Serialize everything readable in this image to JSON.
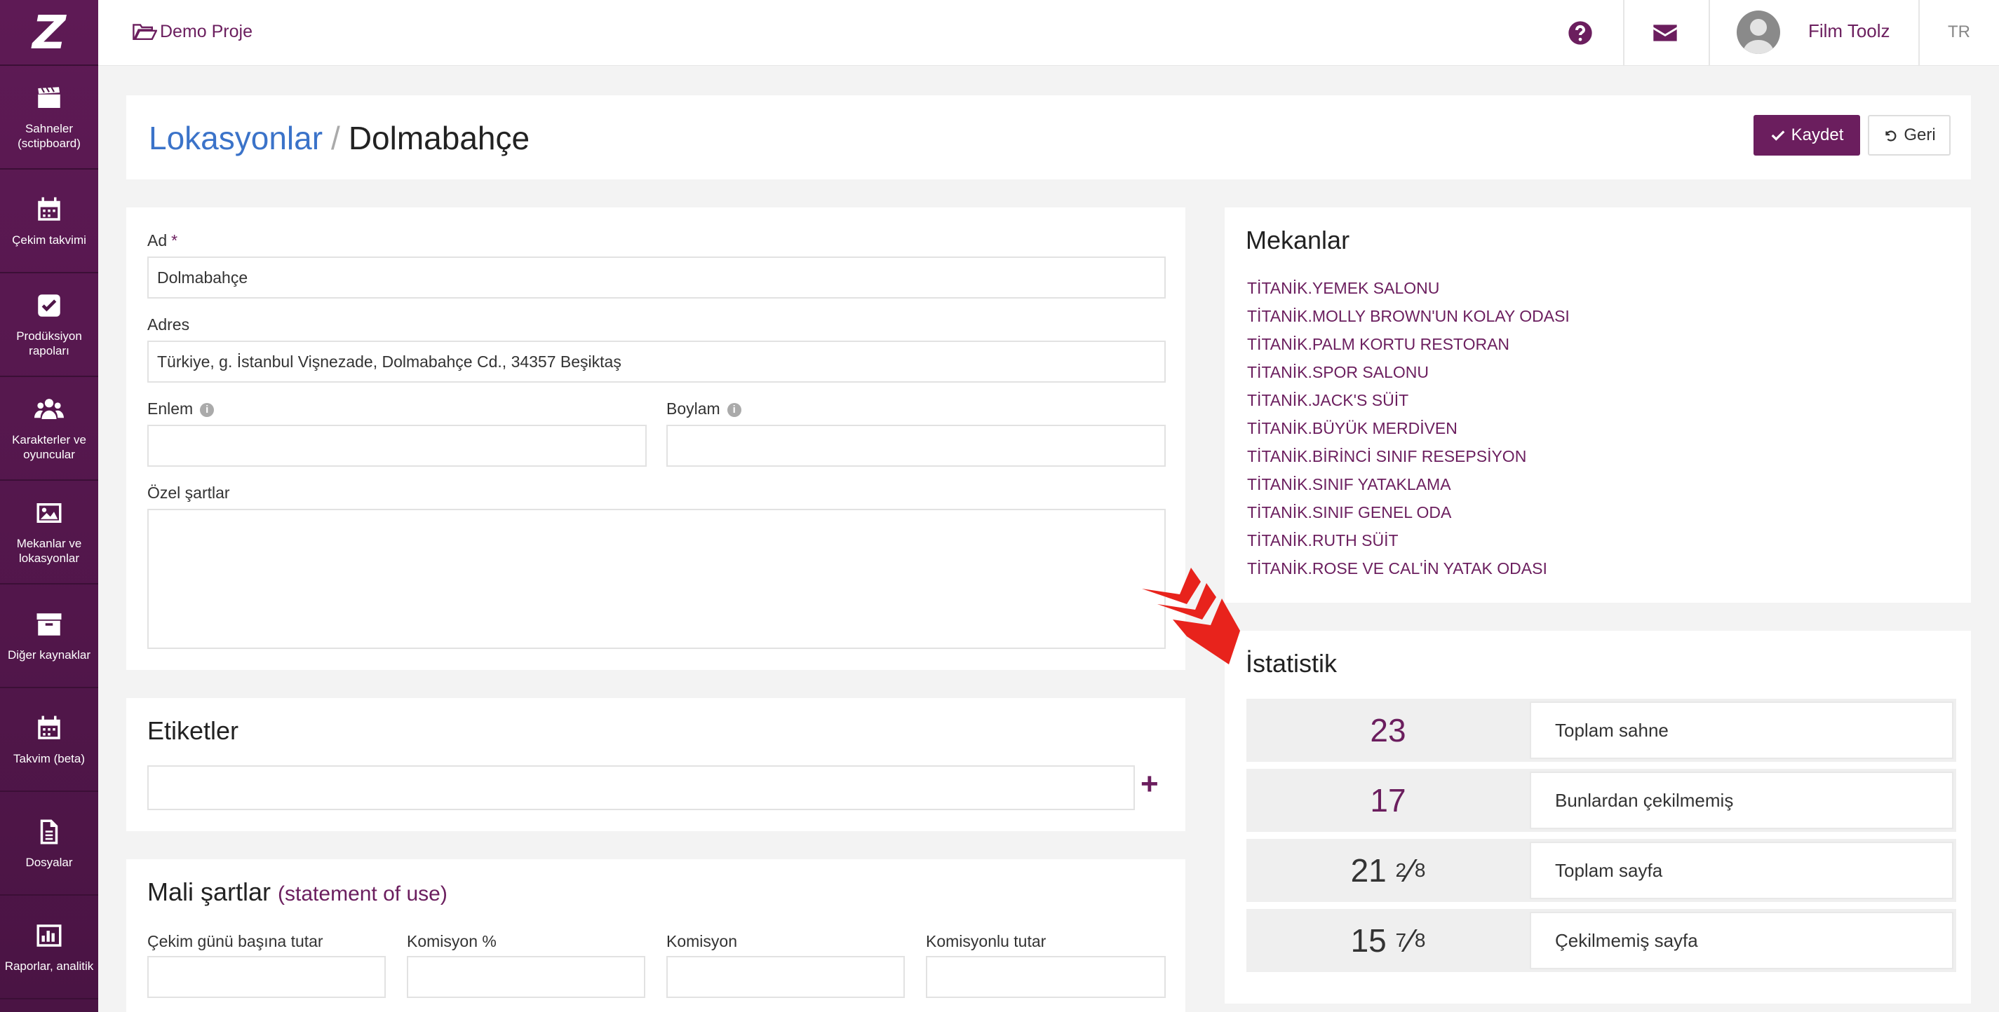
{
  "brand": {
    "logo_letter": "Z"
  },
  "sidebar": {
    "items": [
      {
        "label": "Sahneler (sctipboard)",
        "icon": "clapperboard-icon"
      },
      {
        "label": "Çekim takvimi",
        "icon": "calendar-icon"
      },
      {
        "label": "Prodüksiyon rapoları",
        "icon": "checkbox-icon"
      },
      {
        "label": "Karakterler ve oyuncular",
        "icon": "users-icon"
      },
      {
        "label": "Mekanlar ve lokasyonlar",
        "icon": "image-icon"
      },
      {
        "label": "Diğer kaynaklar",
        "icon": "archive-box-icon"
      },
      {
        "label": "Takvim (beta)",
        "icon": "calendar-icon"
      },
      {
        "label": "Dosyalar",
        "icon": "file-icon"
      },
      {
        "label": "Raporlar, analitik",
        "icon": "bar-chart-icon"
      }
    ]
  },
  "topbar": {
    "project_name": "Demo Proje",
    "user_name": "Film Toolz",
    "language": "TR"
  },
  "header": {
    "breadcrumb_parent": "Lokasyonlar",
    "separator": "/",
    "title": "Dolmabahçe",
    "save_label": "Kaydet",
    "back_label": "Geri"
  },
  "form": {
    "name_label": "Ad",
    "name_required_mark": "*",
    "name_value": "Dolmabahçe",
    "address_label": "Adres",
    "address_value": "Türkiye, g. İstanbul Vişnezade, Dolmabahçe Cd., 34357 Beşiktaş",
    "lat_label": "Enlem",
    "lng_label": "Boylam",
    "lat_value": "",
    "lng_value": "",
    "special_terms_label": "Özel şartlar",
    "special_terms_value": ""
  },
  "tags": {
    "title": "Etiketler",
    "value": "",
    "add_symbol": "+"
  },
  "finance": {
    "title": "Mali şartlar",
    "subtitle": "(statement of use)",
    "cols": [
      "Çekim günü başına tutar",
      "Komisyon %",
      "Komisyon",
      "Komisyonlu tutar"
    ]
  },
  "venues": {
    "title": "Mekanlar",
    "items": [
      "TİTANİK.YEMEK SALONU",
      "TİTANİK.MOLLY BROWN'UN KOLAY ODASI",
      "TİTANİK.PALM KORTU RESTORAN",
      "TİTANİK.SPOR SALONU",
      "TİTANİK.JACK'S SÜİT",
      "TİTANİK.BÜYÜK MERDİVEN",
      "TİTANİK.BİRİNCİ SINIF RESEPSİYON",
      "TİTANİK.SINIF YATAKLAMA",
      "TİTANİK.SINIF GENEL ODA",
      "TİTANİK.RUTH SÜİT",
      "TİTANİK.ROSE VE CAL'İN YATAK ODASI"
    ]
  },
  "stats": {
    "title": "İstatistik",
    "total_scenes": {
      "value": "23",
      "label": "Toplam sahne"
    },
    "unshot_scenes": {
      "value": "17",
      "label": "Bunlardan çekilmemiş"
    },
    "total_pages": {
      "whole": "21",
      "num": "2",
      "den": "8",
      "label": "Toplam sayfa"
    },
    "unshot_pages": {
      "whole": "15",
      "num": "7",
      "den": "8",
      "label": "Çekilmemiş sayfa"
    }
  },
  "colors": {
    "accent": "#6b1e5e",
    "link": "#3b73c9",
    "arrow": "#e8231c"
  }
}
